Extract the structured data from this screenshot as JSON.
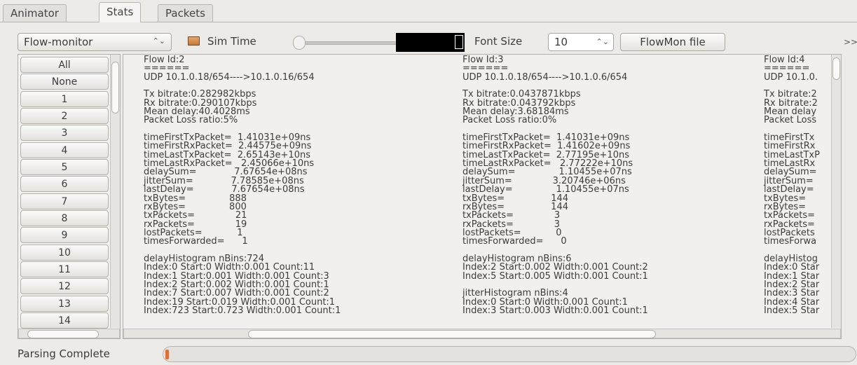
{
  "tabs": [
    {
      "label": "Animator"
    },
    {
      "label": "Stats"
    },
    {
      "label": "Packets"
    }
  ],
  "toolbar": {
    "combo_value": "Flow-monitor",
    "sim_time_label": "Sim Time",
    "font_size_label": "Font Size",
    "font_size_value": "10",
    "flowmon_button": "FlowMon file",
    "more_icon": ">>"
  },
  "flow_list": [
    "All",
    "None",
    "1",
    "2",
    "3",
    "4",
    "5",
    "6",
    "7",
    "8",
    "9",
    "10",
    "11",
    "12",
    "13",
    "14"
  ],
  "flows": [
    {
      "lines": [
        "Flow Id:2",
        "======",
        "UDP 10.1.0.18/654---->10.1.0.16/654",
        "",
        "Tx bitrate:0.282982kbps",
        "Rx bitrate:0.290107kbps",
        "Mean delay:40.4028ms",
        "Packet Loss ratio:5%",
        "",
        "timeFirstTxPacket=  1.41031e+09ns",
        "timeFirstRxPacket=  2.44575e+09ns",
        "timeLastTxPacket=  2.65143e+10ns",
        "timeLastRxPacket=   2.45066e+10ns",
        "delaySum=             7.67654e+08ns",
        "jitterSum=             7.78585e+08ns",
        "lastDelay=             7.67654e+08ns",
        "txBytes=               888",
        "rxBytes=               800",
        "txPackets=              21",
        "rxPackets=              19",
        "lostPackets=            1",
        "timesForwarded=      1",
        "",
        "delayHistogram nBins:724",
        "Index:0 Start:0 Width:0.001 Count:11",
        "Index:1 Start:0.001 Width:0.001 Count:3",
        "Index:2 Start:0.002 Width:0.001 Count:1",
        "Index:7 Start:0.007 Width:0.001 Count:2",
        "Index:19 Start:0.019 Width:0.001 Count:1",
        "Index:723 Start:0.723 Width:0.001 Count:1"
      ]
    },
    {
      "lines": [
        "Flow Id:3",
        "======",
        "UDP 10.1.0.18/654---->10.1.0.6/654",
        "",
        "Tx bitrate:0.0437871kbps",
        "Rx bitrate:0.043792kbps",
        "Mean delay:3.68184ms",
        "Packet Loss ratio:0%",
        "",
        "timeFirstTxPacket=  1.41031e+09ns",
        "timeFirstRxPacket=  1.41602e+09ns",
        "timeLastTxPacket=  2.77195e+10ns",
        "timeLastRxPacket=   2.77222e+10ns",
        "delaySum=               1.10455e+07ns",
        "jitterSum=              3.20746e+06ns",
        "lastDelay=               1.10455e+07ns",
        "txBytes=                144",
        "rxBytes=                144",
        "txPackets=              3",
        "rxPackets=              3",
        "lostPackets=            0",
        "timesForwarded=      0",
        "",
        "delayHistogram nBins:6",
        "Index:2 Start:0.002 Width:0.001 Count:2",
        "Index:5 Start:0.005 Width:0.001 Count:1",
        "",
        "jitterHistogram nBins:4",
        "Index:0 Start:0 Width:0.001 Count:1",
        "Index:3 Start:0.003 Width:0.001 Count:1"
      ]
    },
    {
      "lines": [
        "Flow Id:4",
        "======",
        "UDP 10.1.0.",
        "",
        "Tx bitrate:2",
        "Rx bitrate:2",
        "Mean delay",
        "Packet Loss",
        "",
        "timeFirstTx",
        "timeFirstRx",
        "timeLastTxP",
        "timeLastRx",
        "delaySum=",
        "jitterSum=",
        "lastDelay=",
        "txBytes=",
        "rxBytes=",
        "txPackets=",
        "rxPackets=",
        "lostPackets",
        "timesForwa",
        "",
        "delayHistog",
        "Index:0 Star",
        "Index:1 Star",
        "Index:2 Star",
        "Index:3 Star",
        "Index:4 Star",
        "Index:5 Star"
      ]
    }
  ],
  "status": {
    "text": "Parsing Complete",
    "progress": 0.01
  }
}
